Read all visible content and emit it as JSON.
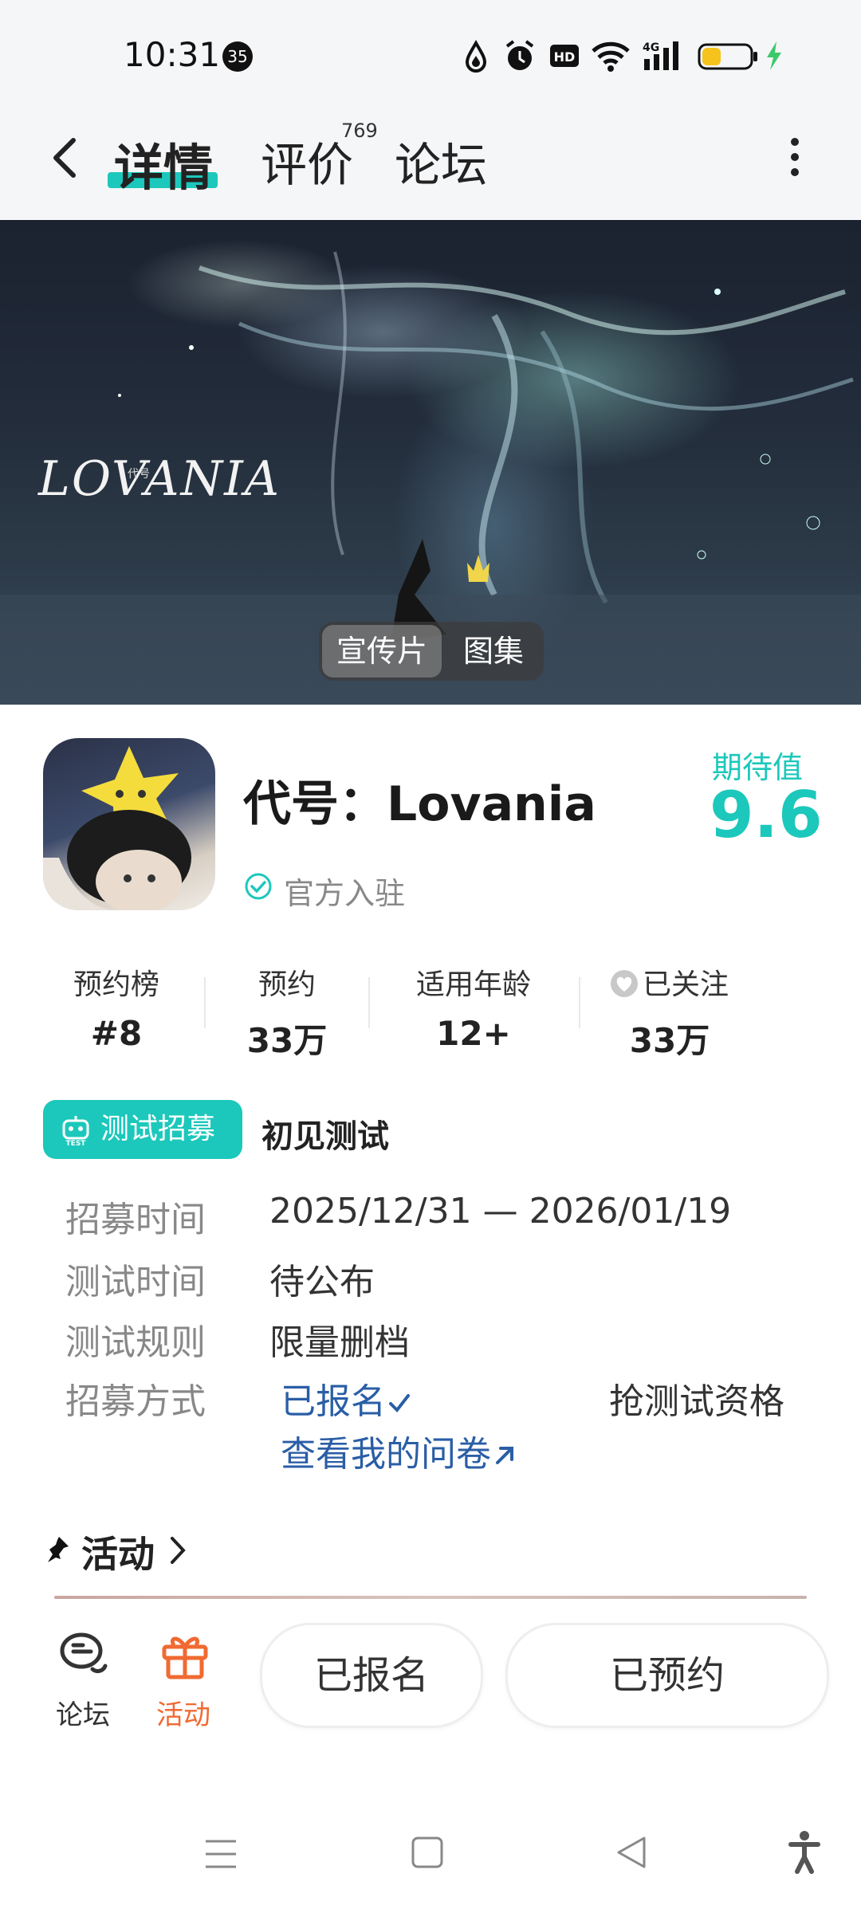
{
  "status_bar": {
    "time": "10:31",
    "notification_count": "35",
    "icons": [
      "data-saver-icon",
      "alarm-icon",
      "hd-icon",
      "wifi-icon",
      "4g-signal-icon",
      "battery-icon",
      "charging-icon"
    ],
    "battery_level": 0.4,
    "battery_color": "#f6c31c"
  },
  "header": {
    "tabs": [
      {
        "label": "详情",
        "active": true
      },
      {
        "label": "评价",
        "count": "769"
      },
      {
        "label": "论坛"
      }
    ],
    "accent": "#1cc8bb"
  },
  "banner": {
    "title": "LOVANIA",
    "title_small": "代号",
    "buttons": [
      "宣传片",
      "图集"
    ],
    "selected": "宣传片"
  },
  "game": {
    "name": "代号：Lovania",
    "verified_label": "官方入驻",
    "expect_label": "期待值",
    "expect_value": "9.6"
  },
  "stats": [
    {
      "label": "预约榜",
      "value": "#8"
    },
    {
      "label": "预约",
      "value": "33万"
    },
    {
      "label": "适用年龄",
      "value": "12+"
    },
    {
      "label": "已关注",
      "value": "33万"
    }
  ],
  "recruitment": {
    "badge": "测试招募",
    "test_name": "初见测试",
    "rows": [
      {
        "label": "招募时间",
        "value": "2025/12/31 — 2026/01/19"
      },
      {
        "label": "测试时间",
        "value": "待公布"
      },
      {
        "label": "测试规则",
        "value": "限量删档"
      },
      {
        "label": "招募方式",
        "value": ""
      }
    ],
    "registered_link": "已报名",
    "questionnaire_link": "查看我的问卷",
    "grab_label": "抢测试资格"
  },
  "activity": {
    "title": "活动"
  },
  "bottom_bar": {
    "forum_label": "论坛",
    "activity_label": "活动",
    "signup_button": "已报名",
    "reserve_button": "已预约",
    "activity_color": "#f06a32"
  }
}
